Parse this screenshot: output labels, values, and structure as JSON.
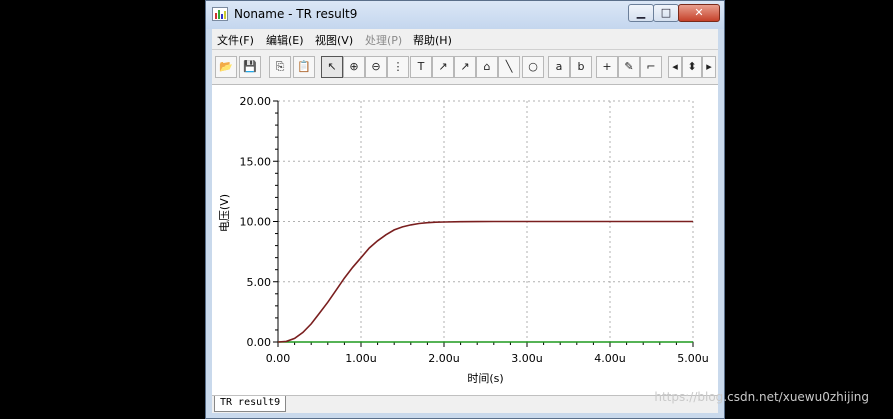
{
  "window": {
    "title": "Noname - TR result9",
    "controls": [
      "minimize",
      "maximize",
      "close"
    ]
  },
  "menu": {
    "items": [
      {
        "label": "文件(F)",
        "enabled": true
      },
      {
        "label": "编辑(E)",
        "enabled": true
      },
      {
        "label": "视图(V)",
        "enabled": true
      },
      {
        "label": "处理(P)",
        "enabled": false
      },
      {
        "label": "帮助(H)",
        "enabled": true
      }
    ]
  },
  "toolbar": {
    "buttons": [
      {
        "icon": "open-folder-icon",
        "glyph": "📂"
      },
      {
        "icon": "save-icon",
        "glyph": "💾"
      },
      {
        "icon": "copy-icon",
        "glyph": "⎘"
      },
      {
        "icon": "paste-icon",
        "glyph": "📋"
      },
      {
        "icon": "pointer-icon",
        "glyph": "↖"
      },
      {
        "icon": "zoom-in-icon",
        "glyph": "⊕"
      },
      {
        "icon": "zoom-100-icon",
        "glyph": "⊖"
      },
      {
        "icon": "grid-icon",
        "glyph": "⋮"
      },
      {
        "icon": "text-icon",
        "glyph": "T"
      },
      {
        "icon": "label-icon",
        "glyph": "↗"
      },
      {
        "icon": "label-2-icon",
        "glyph": "↗"
      },
      {
        "icon": "comment-icon",
        "glyph": "⌂"
      },
      {
        "icon": "line-icon",
        "glyph": "╲"
      },
      {
        "icon": "circle-icon",
        "glyph": "○"
      },
      {
        "icon": "cursor-a-icon",
        "glyph": "a"
      },
      {
        "icon": "cursor-b-icon",
        "glyph": "b"
      },
      {
        "icon": "add-trace-icon",
        "glyph": "+"
      },
      {
        "icon": "probe-icon",
        "glyph": "✎"
      },
      {
        "icon": "step-icon",
        "glyph": "⌐"
      },
      {
        "icon": "scroll-left-icon",
        "glyph": "◂"
      },
      {
        "icon": "scroll-updown-icon",
        "glyph": "⬍"
      },
      {
        "icon": "scroll-right-icon",
        "glyph": "▸"
      }
    ]
  },
  "chart_data": {
    "type": "line",
    "ylabel": "电压(V)",
    "xlabel": "时间(s)",
    "x_ticks": [
      "0.00",
      "1.00u",
      "2.00u",
      "3.00u",
      "4.00u",
      "5.00u"
    ],
    "y_ticks": [
      "0.00",
      "5.00",
      "10.00",
      "15.00",
      "20.00"
    ],
    "xlim": [
      0,
      5
    ],
    "ylim": [
      0,
      20
    ],
    "x_unit": "us",
    "grid": true,
    "series": [
      {
        "color": "#7a1f1f",
        "x": [
          0,
          0.1,
          0.2,
          0.3,
          0.4,
          0.5,
          0.6,
          0.7,
          0.8,
          0.9,
          1.0,
          1.1,
          1.2,
          1.3,
          1.4,
          1.5,
          1.6,
          1.7,
          1.8,
          1.9,
          2.0,
          2.2,
          2.4,
          2.6,
          2.8,
          3.0,
          3.5,
          4.0,
          4.5,
          5.0
        ],
        "y": [
          0,
          0.05,
          0.3,
          0.8,
          1.5,
          2.4,
          3.3,
          4.3,
          5.3,
          6.2,
          7.0,
          7.8,
          8.4,
          8.9,
          9.3,
          9.55,
          9.72,
          9.83,
          9.9,
          9.94,
          9.96,
          9.98,
          9.99,
          10,
          10,
          10,
          10,
          10,
          10,
          10
        ]
      },
      {
        "color": "#1f9a1f",
        "x": [
          0,
          5
        ],
        "y": [
          0,
          0
        ]
      }
    ]
  },
  "tabs": [
    {
      "label": "TR result9"
    }
  ],
  "watermark": "https://blog.csdn.net/xuewu0zhijing"
}
